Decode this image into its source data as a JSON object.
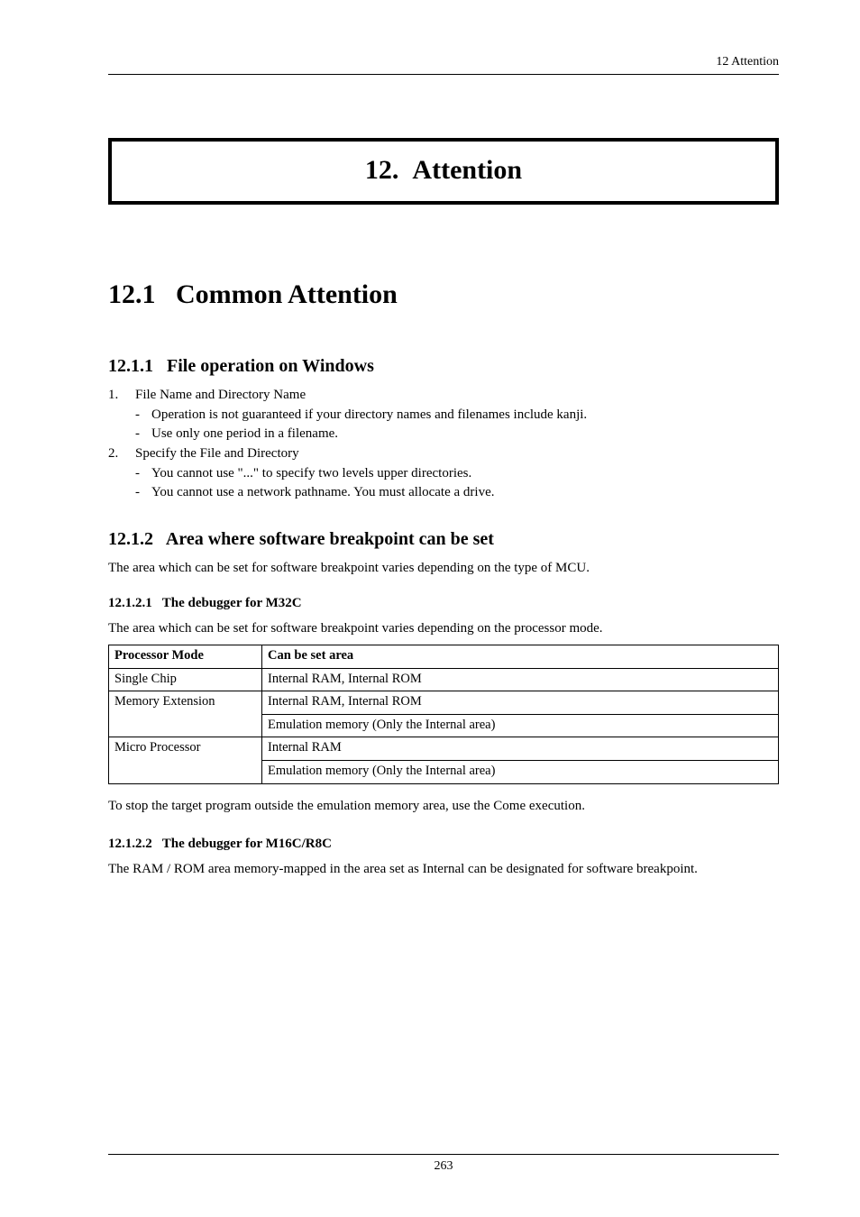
{
  "running_header": "12  Attention",
  "chapter": {
    "number": "12.",
    "title": "Attention"
  },
  "section1": {
    "number": "12.1",
    "title": "Common Attention"
  },
  "subsection1": {
    "number": "12.1.1",
    "title": "File operation on Windows",
    "items": [
      {
        "num": "1.",
        "text": "File Name and Directory Name",
        "dashes": [
          "Operation is not guaranteed if your directory names and filenames include kanji.",
          "Use only one period in a filename."
        ]
      },
      {
        "num": "2.",
        "text": "Specify the File and Directory",
        "dashes": [
          "You cannot use \"...\" to specify two levels upper directories.",
          "You cannot use a network pathname. You must allocate a drive."
        ]
      }
    ]
  },
  "subsection2": {
    "number": "12.1.2",
    "title": "Area where software breakpoint can be set",
    "lead": "The area which can be set for software breakpoint varies depending on the type of MCU."
  },
  "sss1": {
    "number": "12.1.2.1",
    "title": "The debugger for M32C",
    "lead": "The area which can be set for software breakpoint varies depending on the processor mode.",
    "table": {
      "headers": [
        "Processor Mode",
        "Can be set area"
      ],
      "rows": [
        {
          "mode": "Single Chip",
          "lines": [
            "Internal RAM, Internal ROM"
          ]
        },
        {
          "mode": "Memory Extension",
          "lines": [
            "Internal RAM, Internal ROM",
            "Emulation memory (Only the Internal area)"
          ]
        },
        {
          "mode": "Micro Processor",
          "lines": [
            "Internal RAM",
            "Emulation memory (Only the Internal area)"
          ]
        }
      ]
    },
    "after": "To stop the target program outside the emulation memory area, use the Come execution."
  },
  "sss2": {
    "number": "12.1.2.2",
    "title": "The debugger for M16C/R8C",
    "para": "The RAM / ROM area memory-mapped in the area set as Internal can be designated for software breakpoint."
  },
  "page_number": "263"
}
